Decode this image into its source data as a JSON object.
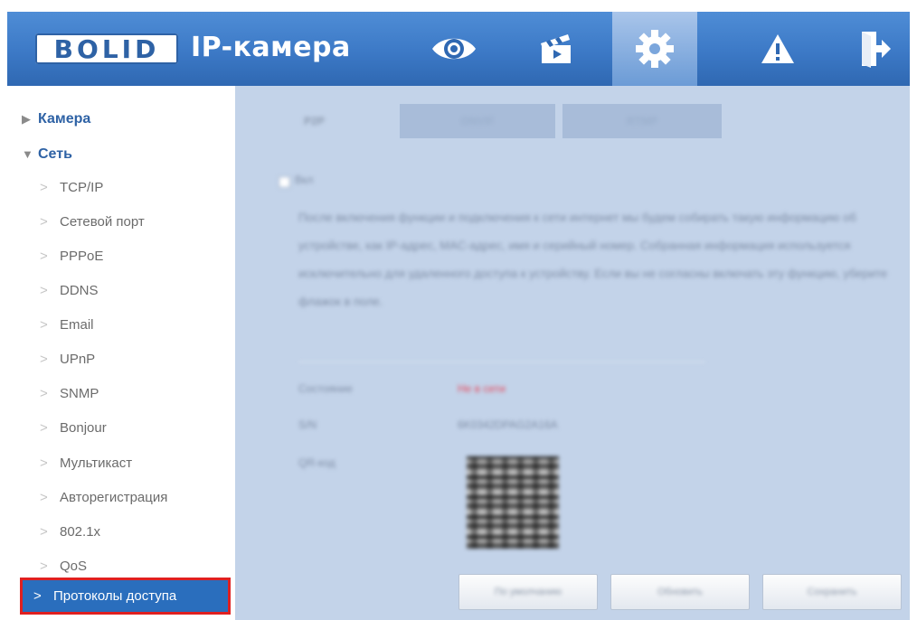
{
  "header": {
    "logo_text": "BOLID",
    "app_title": "IP-камера",
    "nav_icons": [
      "live-view-eye-icon",
      "playback-clapperboard-icon",
      "settings-gear-icon",
      "alarm-warning-icon",
      "logout-door-icon"
    ],
    "active_nav": "settings-gear-icon",
    "colors": {
      "header_blue": "#3c79c6",
      "active_tab": "#8db2e3",
      "icon": "#ffffff"
    }
  },
  "sidebar": {
    "groups": [
      {
        "label": "Камера",
        "expanded": false
      },
      {
        "label": "Сеть",
        "expanded": true
      }
    ],
    "items": [
      "TCP/IP",
      "Сетевой порт",
      "PPPoE",
      "DDNS",
      "Email",
      "UPnP",
      "SNMP",
      "Bonjour",
      "Мультикаст",
      "Авторегистрация",
      "802.1x",
      "QoS"
    ],
    "active_item": "Протоколы доступа",
    "colors": {
      "group_text": "#2e62a5",
      "item_text": "#6b6b6b",
      "active_bg": "#2a6ebd",
      "highlight_border": "#e02020"
    }
  },
  "content": {
    "tabs": [
      "P2P",
      "ONVIF",
      "RTMP"
    ],
    "active_tab": "P2P",
    "enable_label": "Вкл",
    "description": "После включения функции и подключения к сети интернет мы будем собирать такую информацию об устройстве, как IP-адрес, MAC-адрес, имя и серийный номер. Собранная информация используется исключительно для удаленного доступа к устройству. Если вы не согласны включать эту функцию, уберите флажок в поле.",
    "status_label": "Состояние",
    "status_value": "Не в сети",
    "sn_label": "S/N",
    "sn_value": "6K0342DPAG2A16A",
    "qr_label": "QR-код",
    "buttons": [
      "По умолчанию",
      "Обновить",
      "Сохранить"
    ],
    "colors": {
      "panel_bg": "#c3d3e9",
      "status_value": "#e8475a"
    }
  }
}
